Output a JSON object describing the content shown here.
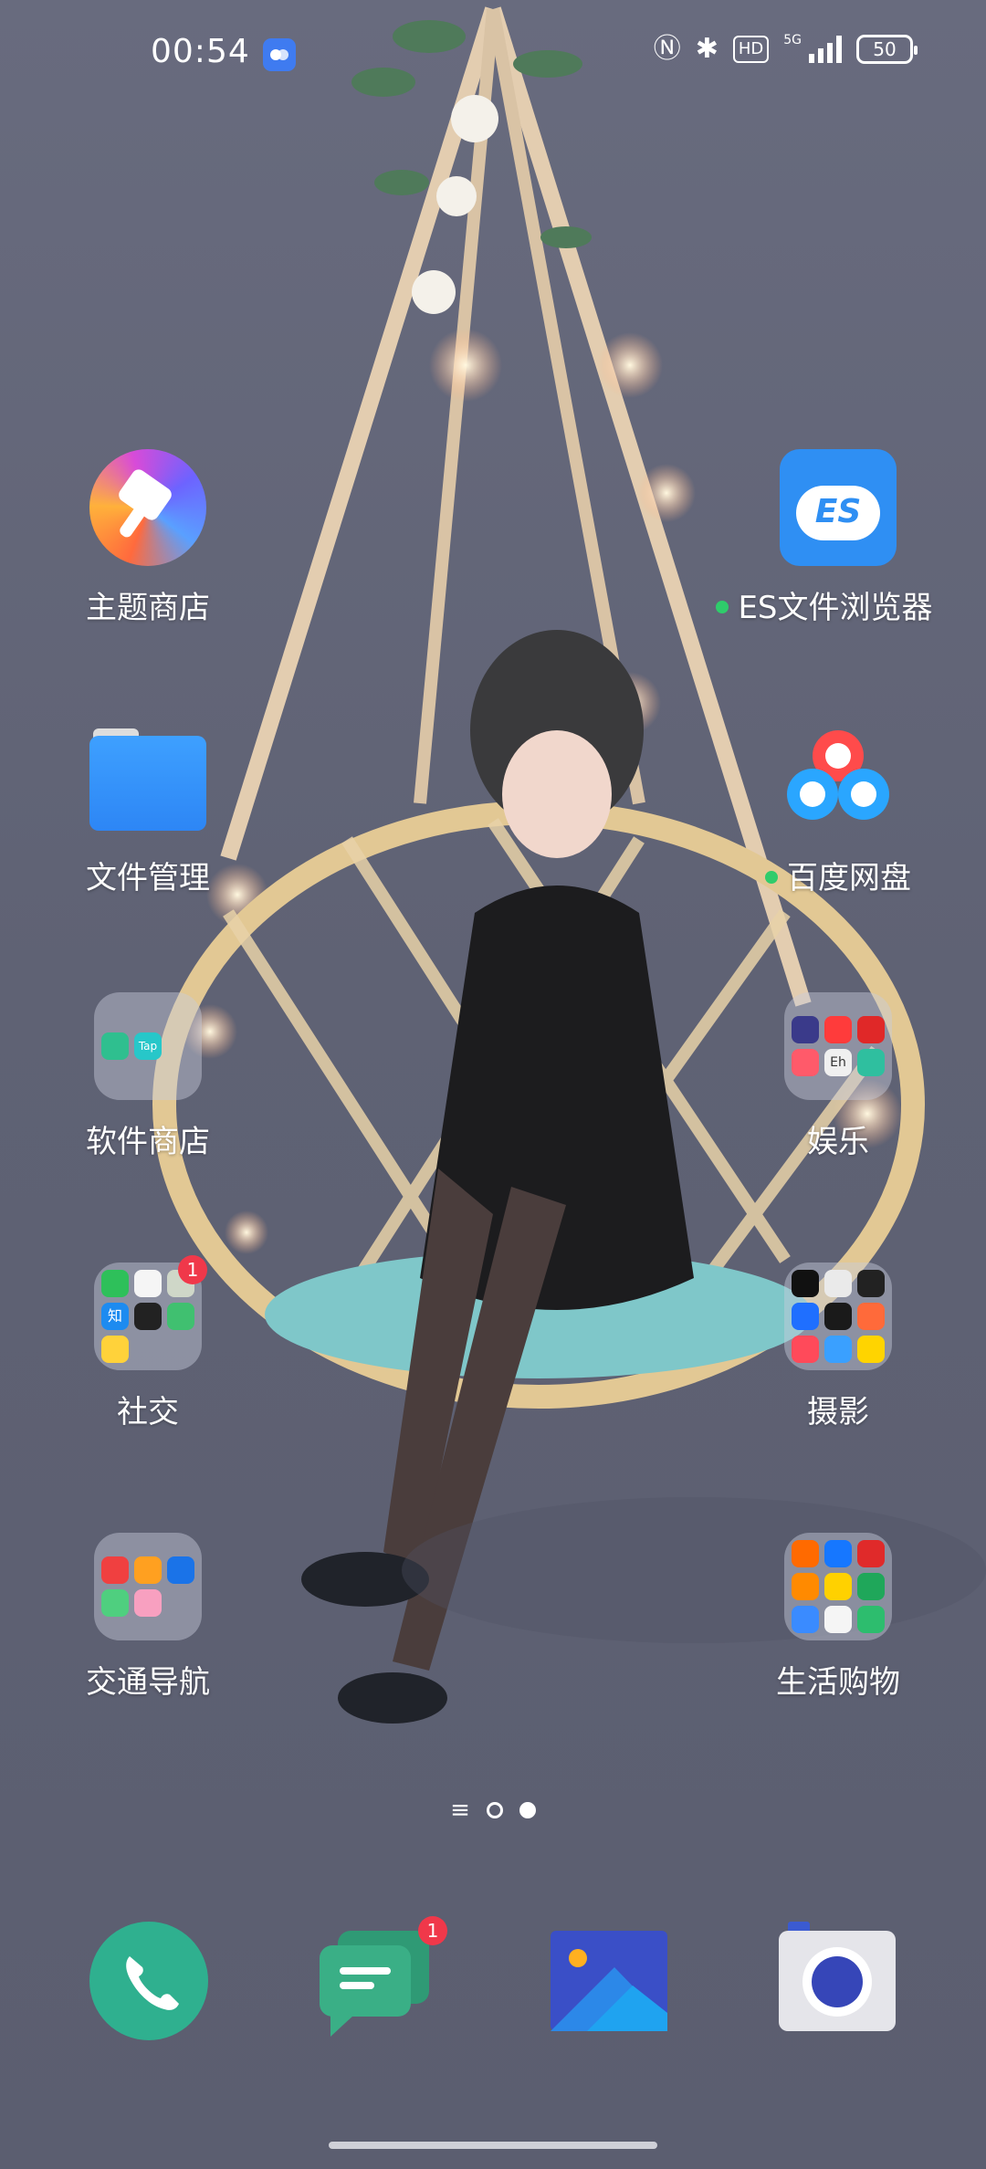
{
  "status_bar": {
    "time": "00:54",
    "network": "5G",
    "hd": "HD",
    "battery": "50"
  },
  "home": {
    "apps": [
      {
        "label": "主题商店",
        "icon": "theme-store-icon"
      },
      {
        "label": "ES文件浏览器",
        "icon": "es-file-explorer-icon",
        "new_dot": true
      },
      {
        "label": "文件管理",
        "icon": "file-manager-icon"
      },
      {
        "label": "百度网盘",
        "icon": "baidu-netdisk-icon",
        "new_dot": true
      }
    ],
    "folders": [
      {
        "label": "软件商店",
        "badge": ""
      },
      {
        "label": "娱乐",
        "badge": ""
      },
      {
        "label": "社交",
        "badge": "1"
      },
      {
        "label": "摄影",
        "badge": ""
      },
      {
        "label": "交通导航",
        "badge": ""
      },
      {
        "label": "生活购物",
        "badge": ""
      }
    ],
    "es_text": "ES",
    "folder_mini_labels": {
      "tap": "Tap",
      "zhi": "知",
      "eh": "Eh"
    }
  },
  "pager": {
    "pages": 2,
    "current": 2
  },
  "dock": {
    "message_badge": "1",
    "items": [
      "phone-icon",
      "messages-icon",
      "gallery-icon",
      "camera-icon"
    ]
  }
}
